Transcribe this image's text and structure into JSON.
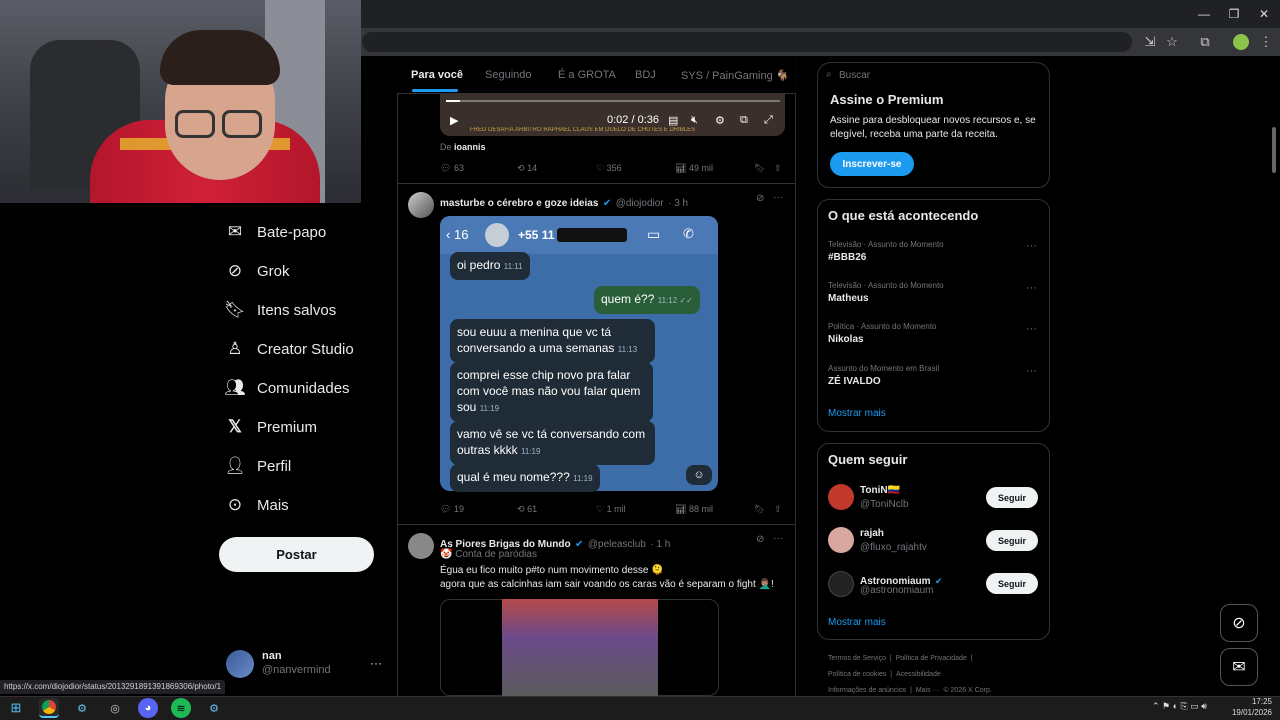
{
  "browser": {
    "window_controls": {
      "minimize": "—",
      "restore": "❐",
      "close": "✕"
    },
    "toolbar_icons": [
      "install-icon",
      "star-icon",
      "extensions-icon",
      "profile-icon",
      "menu-icon"
    ]
  },
  "sidebar": {
    "items": [
      {
        "label": "Bate-papo",
        "icon": "mail-icon"
      },
      {
        "label": "Grok",
        "icon": "grok-icon"
      },
      {
        "label": "Itens salvos",
        "icon": "bookmark-icon"
      },
      {
        "label": "Creator Studio",
        "icon": "creator-icon"
      },
      {
        "label": "Comunidades",
        "icon": "communities-icon"
      },
      {
        "label": "Premium",
        "icon": "x-icon"
      },
      {
        "label": "Perfil",
        "icon": "person-icon"
      },
      {
        "label": "Mais",
        "icon": "more-icon"
      }
    ],
    "post_button": "Postar",
    "account": {
      "name": "nan",
      "handle": "@nanvermind"
    }
  },
  "tabs": [
    "Para você",
    "Seguindo",
    "É a GROTA",
    "BDJ",
    "SYS / PainGaming 🐐"
  ],
  "post1": {
    "video_time": "0:02 / 0:36",
    "video_caption": "FRED DESAFIA ÁRBITRO RAPHAEL CLAUS EM DUELO DE CHUTES E DRIBLES",
    "from_prefix": "De",
    "from_user": "ioannis",
    "stats": {
      "replies": "63",
      "reposts": "14",
      "likes": "356",
      "views": "49 mil"
    }
  },
  "post2": {
    "name": "masturbe o cérebro e goze ideias",
    "handle": "@diojodior",
    "time": "· 3 h",
    "chat": {
      "back_count": "16",
      "phone": "+55 11",
      "messages": [
        {
          "text": "oi pedro",
          "time": "11:11",
          "me": false
        },
        {
          "text": "quem é??",
          "time": "11:12 ✓✓",
          "me": true
        },
        {
          "text": "sou euuu a menina que vc tá conversando a uma semanas",
          "time": "11:13",
          "me": false
        },
        {
          "text": "comprei esse chip novo pra falar com você mas não vou falar quem sou",
          "time": "11:19",
          "me": false
        },
        {
          "text": "vamo vê se vc tá conversando com outras kkkk",
          "time": "11:19",
          "me": false
        },
        {
          "text": "qual é meu nome???",
          "time": "11:19",
          "me": false
        }
      ]
    },
    "stats": {
      "replies": "19",
      "reposts": "61",
      "likes": "1 mil",
      "views": "88 mil"
    }
  },
  "post3": {
    "name": "As Piores Brigas do Mundo",
    "handle": "@peleasclub",
    "time": "· 1 h",
    "label": "🤡 Conta de paródias",
    "text1": "Égua eu fico muito p#to num movimento desse 🫠",
    "text2": "agora que as calcinhas iam sair voando os caras vão é separam o fight 🤦🏽‍♂️!"
  },
  "right": {
    "search_placeholder": "Buscar",
    "premium": {
      "title": "Assine o Premium",
      "text": "Assine para desbloquear novos recursos e, se elegível, receba uma parte da receita.",
      "button": "Inscrever-se"
    },
    "trends": {
      "title": "O que está acontecendo",
      "items": [
        {
          "meta": "Televisão · Assunto do Momento",
          "name": "#BBB26"
        },
        {
          "meta": "Televisão · Assunto do Momento",
          "name": "Matheus"
        },
        {
          "meta": "Política · Assunto do Momento",
          "name": "Nikolas"
        },
        {
          "meta": "Assunto do Momento em Brasil",
          "name": "ZÉ IVALDO"
        }
      ],
      "more": "Mostrar mais"
    },
    "who_to_follow": {
      "title": "Quem seguir",
      "users": [
        {
          "name": "ToniN🇨🇴",
          "handle": "@ToniNclb",
          "button": "Seguir",
          "color": "#c0392b"
        },
        {
          "name": "rajah",
          "handle": "@fluxo_rajahtv",
          "button": "Seguir",
          "color": "#d8a7a0"
        },
        {
          "name": "Astronomiaum",
          "handle": "@astronomiaum",
          "button": "Seguir",
          "color": "#222"
        }
      ],
      "more": "Mostrar mais"
    },
    "footer": {
      "row1": [
        "Termos de Serviço",
        "|",
        "Política de Privacidade",
        "|"
      ],
      "row2": [
        "Política de cookies",
        "|",
        "Acessibilidade"
      ],
      "row3": [
        "Informações de anúncios",
        "|",
        "Mais ···",
        "© 2026 X Corp."
      ]
    }
  },
  "status_url": "https://x.com/diojodior/status/2013291891391869306/photo/1",
  "taskbar": {
    "time": "17:25",
    "date": "19/01/2026"
  }
}
